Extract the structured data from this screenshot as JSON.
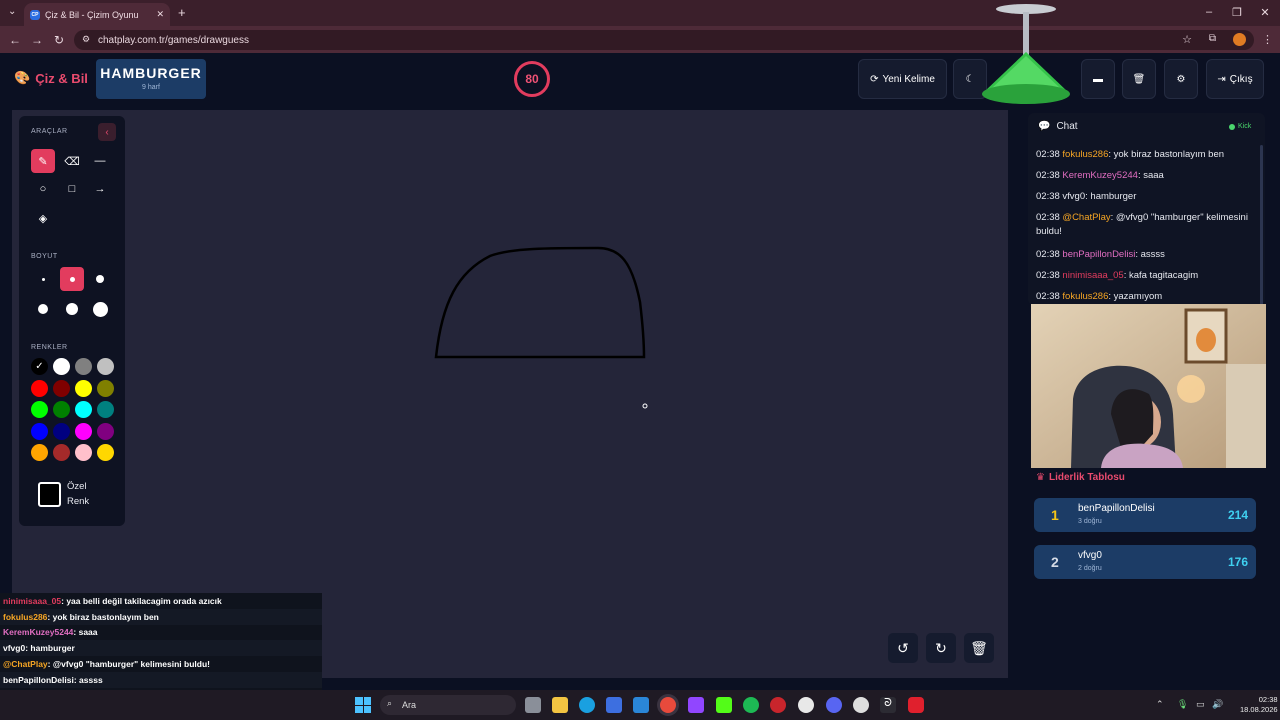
{
  "browser": {
    "tab_title": "Çiz & Bil - Çizim Oyunu",
    "tab_favicon": "CP",
    "url": "chatplay.com.tr/games/drawguess"
  },
  "header": {
    "logo": "Çiz & Bil",
    "word": "HAMBURGER",
    "word_hint": "9 harf",
    "timer": "80",
    "new_word_label": "Yeni Kelime",
    "exit_label": "Çıkış"
  },
  "tools": {
    "section_tools": "ARAÇLAR",
    "section_size": "BOYUT",
    "section_colors": "RENKLER",
    "custom_color_line1": "Özel",
    "custom_color_line2": "Renk",
    "tool_icons": [
      "brush-icon",
      "eraser-icon",
      "line-icon",
      "circle-icon",
      "square-icon",
      "arrow-icon",
      "fill-bucket-icon"
    ],
    "colors": [
      "#000000",
      "#ffffff",
      "#808080",
      "#c0c0c0",
      "#ff0000",
      "#800000",
      "#ffff00",
      "#808000",
      "#00ff00",
      "#008000",
      "#00ffff",
      "#008080",
      "#0000ff",
      "#000080",
      "#ff00ff",
      "#800080",
      "#ffa500",
      "#a52a2a",
      "#ffc0cb",
      "#ffd700"
    ]
  },
  "chat": {
    "title": "Chat",
    "badge": "Kick",
    "messages": [
      {
        "time": "02:38",
        "user": "fokulus286",
        "color": "#f5a524",
        "text": ": yok biraz bastonlayım ben"
      },
      {
        "time": "02:38",
        "user": "KeremKuzey5244",
        "color": "#e16ec1",
        "text": ": saaa"
      },
      {
        "time": "02:38",
        "user": "vfvg0",
        "color": "#e6e8ef",
        "text": ": hamburger"
      },
      {
        "time": "02:38",
        "user": "@ChatPlay",
        "color": "#f5a524",
        "text": ": @vfvg0 \"hamburger\" kelimesini buldu!"
      },
      {
        "time": "02:38",
        "user": "benPapillonDelisi",
        "color": "#e16ec1",
        "text": ": assss"
      },
      {
        "time": "02:38",
        "user": "ninimisaaa_05",
        "color": "#e23c5e",
        "text": ": kafa tagitacagim"
      },
      {
        "time": "02:38",
        "user": "fokulus286",
        "color": "#f5a524",
        "text": ": yazamıyom"
      }
    ]
  },
  "leaderboard": {
    "title": "Liderlik Tablosu",
    "rows": [
      {
        "rank": "1",
        "name": "benPapillonDelisi",
        "sub": "3 doğru",
        "score": "214",
        "rank_color": "#f5c518"
      },
      {
        "rank": "2",
        "name": "vfvg0",
        "sub": "2 doğru",
        "score": "176",
        "rank_color": "#d5dbe6"
      }
    ]
  },
  "overlay_chat": [
    {
      "user": "ninimisaaa_05",
      "color": "#e23c5e",
      "text": ": yaa belli değil takilacagim orada azıcık"
    },
    {
      "user": "fokulus286",
      "color": "#f5a524",
      "text": ": yok biraz bastonlayım ben"
    },
    {
      "user": "KeremKuzey5244",
      "color": "#e16ec1",
      "text": ": saaa"
    },
    {
      "user": "vfvg0",
      "color": "#ffffff",
      "text": ": hamburger"
    },
    {
      "user": "@ChatPlay",
      "color": "#f5a524",
      "text": ": @vfvg0 \"hamburger\" kelimesini buldu!"
    },
    {
      "user": "benPapillonDelisi",
      "color": "#ffffff",
      "text": ": assss"
    },
    {
      "user": "ninimisaaa_05",
      "color": "#e23c5e",
      "text": ": kafa tagitacagim"
    },
    {
      "user": "fokulus286",
      "color": "#f5a524",
      "text": ": yazamıyom"
    }
  ],
  "taskbar": {
    "search_placeholder": "Ara",
    "time": "02:38",
    "date": "18.08.2026"
  },
  "accent": "#e23c5e"
}
